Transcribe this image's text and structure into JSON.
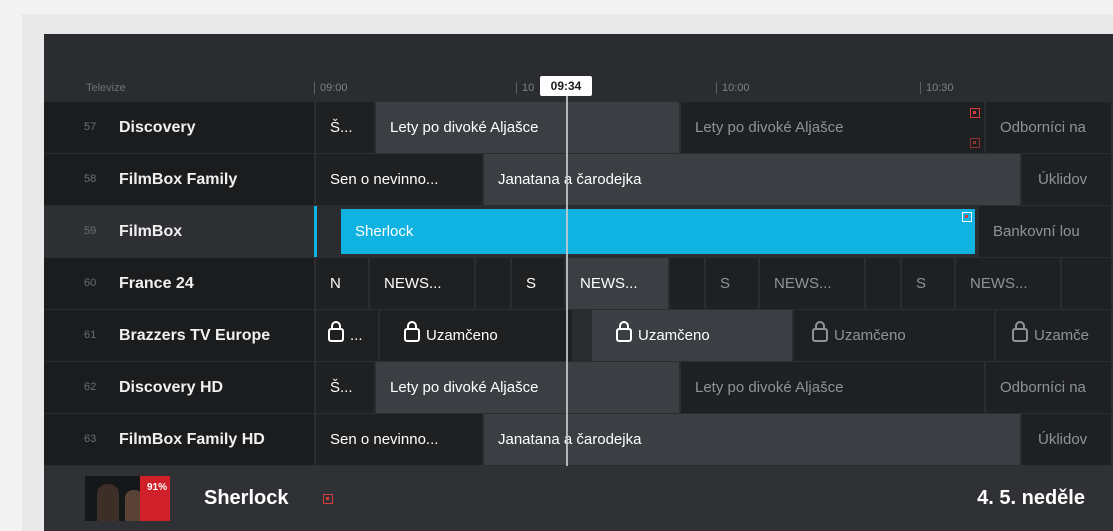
{
  "timeline": {
    "label": "Televize",
    "ticks": [
      "09:00",
      "10:00",
      "10:30"
    ],
    "hidden_tick": "10",
    "now": "09:34"
  },
  "channels": [
    {
      "number": "57",
      "name": "Discovery",
      "programs": [
        "Š...",
        "Lety po divoké Aljašce",
        "Lety po divoké Aljašce",
        "Odborníci na"
      ]
    },
    {
      "number": "58",
      "name": "FilmBox Family",
      "programs": [
        "Sen o nevinno...",
        "Janatana a čarodejka",
        "Úklidov"
      ]
    },
    {
      "number": "59",
      "name": "FilmBox",
      "programs": [
        "Sherlock",
        "Bankovní lou"
      ]
    },
    {
      "number": "60",
      "name": "France 24",
      "programs": [
        "N",
        "NEWS...",
        "S",
        "NEWS...",
        "S",
        "NEWS...",
        "S",
        "NEWS..."
      ]
    },
    {
      "number": "61",
      "name": "Brazzers TV Europe",
      "programs": [
        "...",
        "Uzamčeno",
        "Uzamčeno",
        "Uzamčeno",
        "Uzamče"
      ]
    },
    {
      "number": "62",
      "name": "Discovery HD",
      "programs": [
        "Š...",
        "Lety po divoké Aljašce",
        "Lety po divoké Aljašce",
        "Odborníci na"
      ]
    },
    {
      "number": "63",
      "name": "FilmBox Family HD",
      "programs": [
        "Sen o nevinno...",
        "Janatana a čarodejka",
        "Úklidov"
      ]
    }
  ],
  "selected_channel": "FilmBox",
  "detail": {
    "title": "Sherlock",
    "rating": "91%",
    "date": "4. 5. neděle"
  },
  "colors": {
    "accent": "#0fb2e0",
    "record": "#d63b3b",
    "background": "#2a2c2f"
  }
}
